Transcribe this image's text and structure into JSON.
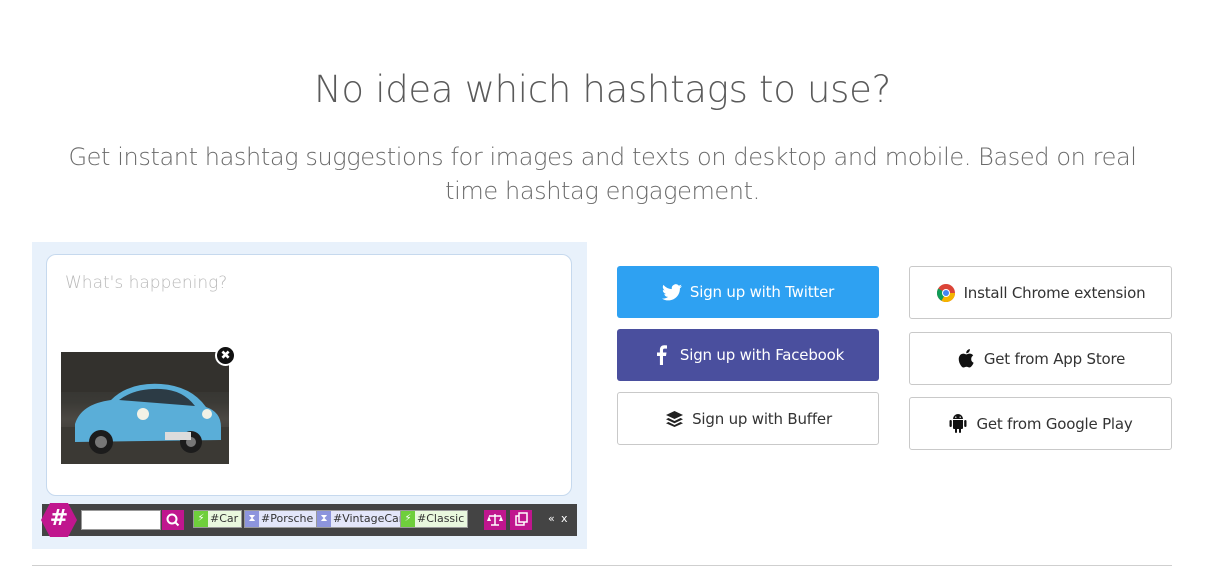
{
  "hero": {
    "title": "No idea which hashtags to use?",
    "subtitle": "Get instant hashtag suggestions for images and texts on desktop and mobile. Based on real time hashtag engagement."
  },
  "demo": {
    "composer_placeholder": "What's happening?",
    "toolbar": {
      "logo_glyph": "#",
      "tags": [
        {
          "label": "#Car",
          "status": "trending"
        },
        {
          "label": "#Porsche",
          "status": "long-life"
        },
        {
          "label": "#VintageCar",
          "status": "long-life"
        },
        {
          "label": "#Classic",
          "status": "trending"
        }
      ],
      "collapse_glyph": "«",
      "close_glyph": "x"
    },
    "remove_glyph": "✖"
  },
  "actions": {
    "twitter": "Sign up with Twitter",
    "facebook": "Sign up with Facebook",
    "buffer": "Sign up with Buffer",
    "chrome": "Install Chrome extension",
    "appstore": "Get from App Store",
    "googleplay": "Get from Google Play"
  },
  "colors": {
    "twitter": "#2ea1f2",
    "facebook": "#4a4f9e",
    "brand_magenta": "#c0168e",
    "panel_bg": "#e8f1fb"
  },
  "icons": [
    "twitter-icon",
    "facebook-icon",
    "buffer-icon",
    "chrome-icon",
    "apple-icon",
    "android-icon",
    "search-icon",
    "close-icon"
  ]
}
